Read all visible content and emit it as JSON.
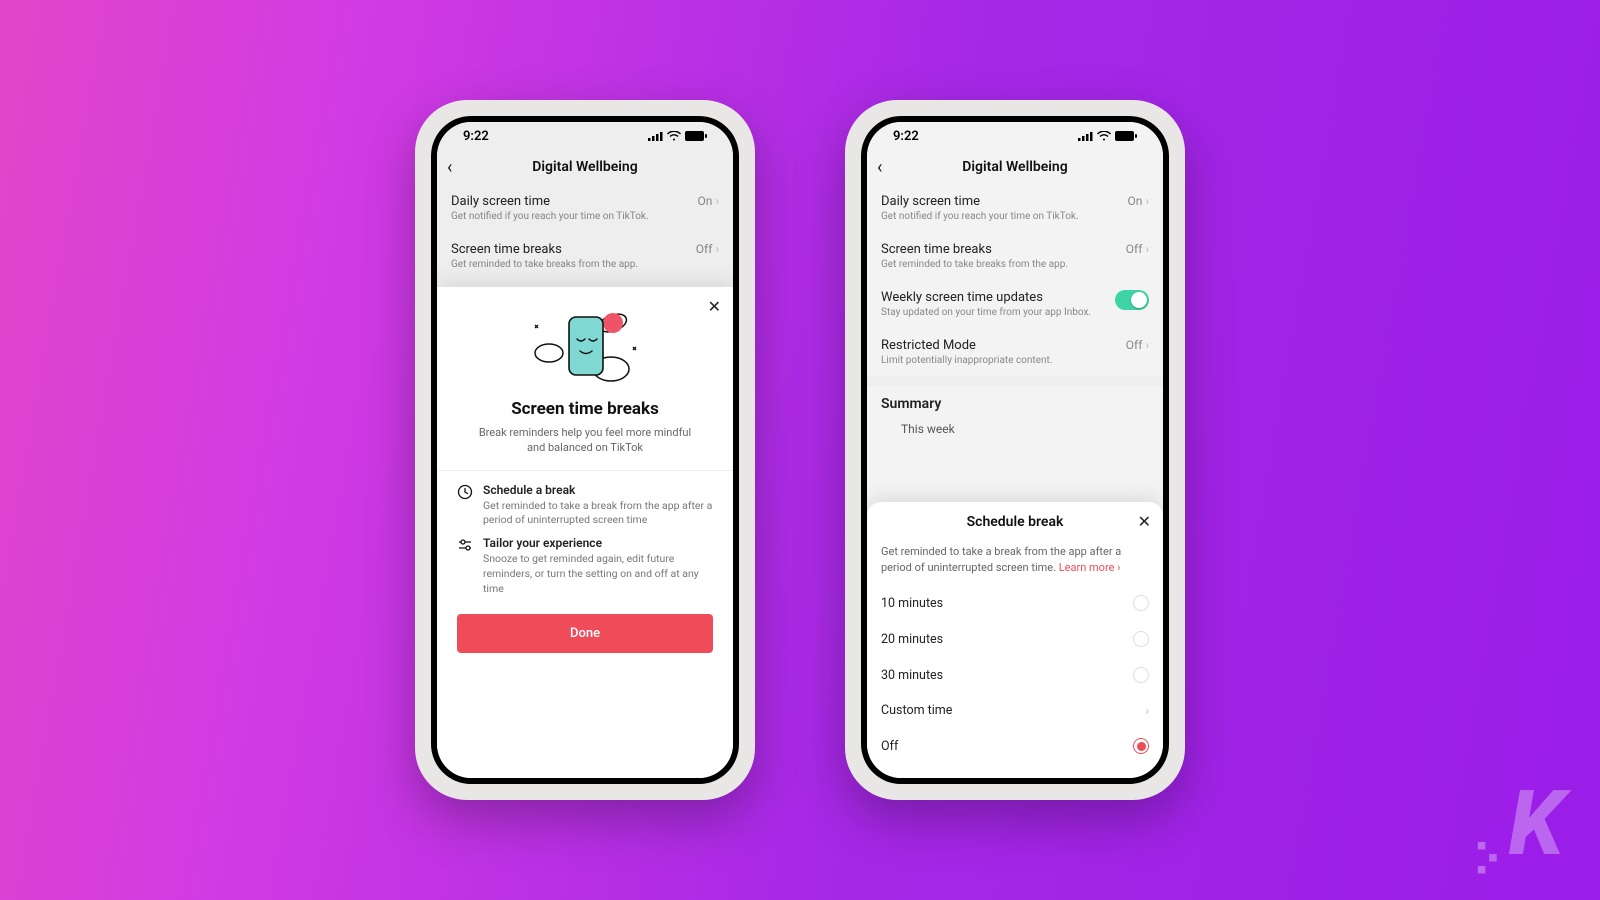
{
  "status": {
    "time": "9:22"
  },
  "nav": {
    "title": "Digital Wellbeing"
  },
  "settings": {
    "daily": {
      "title": "Daily screen time",
      "sub": "Get notified if you reach your time on TikTok.",
      "value": "On"
    },
    "breaks": {
      "title": "Screen time breaks",
      "sub": "Get reminded to take breaks from the app.",
      "value": "Off"
    },
    "weekly": {
      "title": "Weekly screen time updates",
      "sub": "Stay updated on your time from your app Inbox."
    },
    "restricted": {
      "title": "Restricted Mode",
      "sub": "Limit potentially inappropriate content.",
      "value": "Off"
    },
    "summary": {
      "heading": "Summary",
      "range": "This week"
    }
  },
  "intro": {
    "title": "Screen time breaks",
    "sub": "Break reminders help you feel more mindful and balanced on TikTok",
    "feat1": {
      "title": "Schedule a break",
      "sub": "Get reminded to take a break from the app after a period of uninterrupted screen time"
    },
    "feat2": {
      "title": "Tailor your experience",
      "sub": "Snooze to get reminded again, edit future reminders, or turn the setting on and off at any time"
    },
    "done": "Done"
  },
  "schedule": {
    "title": "Schedule break",
    "desc": "Get reminded to take a break from the app after a period of uninterrupted screen time. ",
    "learn": "Learn more ›",
    "opts": {
      "o10": "10 minutes",
      "o20": "20 minutes",
      "o30": "30 minutes",
      "custom": "Custom time",
      "off": "Off"
    }
  },
  "watermark": "K"
}
